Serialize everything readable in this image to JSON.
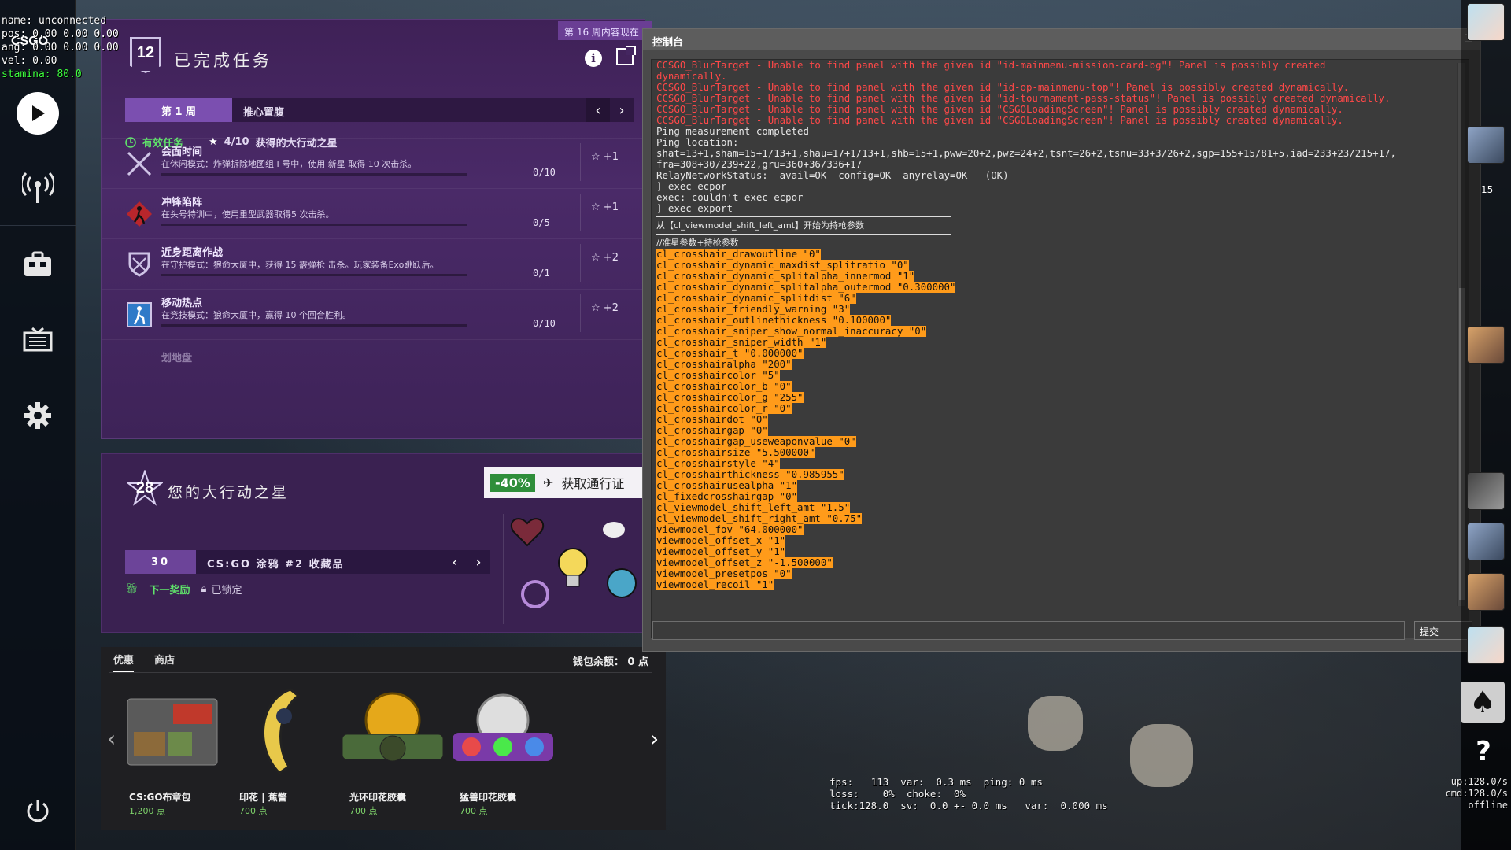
{
  "hud": {
    "line1": "name: unconnected",
    "line2": "pos:  0.00 0.00 0.00",
    "line3": "ang:  0.00 0.00 0.00",
    "line4": "vel:  0.00",
    "stamina": "stamina:  80.0",
    "logo": "CSGO"
  },
  "rail": {
    "play_icon": "play-icon",
    "broadcast_icon": "broadcast-icon",
    "inventory_icon": "briefcase-icon",
    "watch_icon": "tv-icon",
    "settings_icon": "gear-icon",
    "power_icon": "power-icon"
  },
  "missions": {
    "badge_number": "12",
    "title": "已完成任务",
    "week_tag": "第 16 周内容现在",
    "week_label": "第 1 周",
    "week_name": "推心置腹",
    "active_label": "有效任务",
    "stars_progress": "4/10",
    "stars_label": "获得的大行动之星",
    "items": [
      {
        "title": "会面时间",
        "desc": "在休闲模式：炸弹拆除地图组 I 号中，使用 新星 取得 10 次击杀。",
        "progress": "0/10",
        "reward": "+1",
        "icon": "crossed-swords-icon",
        "fraction": 0.0
      },
      {
        "title": "冲锋陷阵",
        "desc": "在头号特训中，使用重型武器取得5 次击杀。",
        "progress": "0/5",
        "reward": "+1",
        "icon": "running-man-icon",
        "fraction": 0.0
      },
      {
        "title": "近身距离作战",
        "desc": "在守护模式：狼命大厦中，获得 15 霰弹枪 击杀。玩家装备Exo跳跃后。",
        "progress": "0/1",
        "reward": "+2",
        "icon": "shield-icon",
        "fraction": 0.0
      },
      {
        "title": "移动热点",
        "desc": "在竞技模式：狼命大厦中，赢得 10 个回合胜利。",
        "progress": "0/10",
        "reward": "+2",
        "icon": "ct-player-icon",
        "fraction": 0.0
      }
    ],
    "partial_item": "划地盘"
  },
  "stars": {
    "count": "28",
    "title": "您的大行动之星",
    "discount": "-40%",
    "pass_label": "获取通行证",
    "collection_num": "30",
    "collection_name": "CS:GO 涂鸦 #2 收藏品",
    "next_reward": "下一奖励",
    "locked": "已锁定"
  },
  "store": {
    "tab_deals": "优惠",
    "tab_store": "商店",
    "wallet": "钱包余额： 0 点",
    "items": [
      {
        "name": "CS:GO布章包",
        "price": "1,200 点"
      },
      {
        "name": "印花 | 蕉警",
        "price": "700 点"
      },
      {
        "name": "光环印花胶囊",
        "price": "700 点"
      },
      {
        "name": "猛兽印花胶囊",
        "price": "700 点"
      }
    ]
  },
  "console": {
    "title": "控制台",
    "errors": [
      "CCSGO_BlurTarget - Unable to find panel with the given id \"id-mainmenu-mission-card-bg\"! Panel is possibly created",
      "dynamically.",
      "CCSGO_BlurTarget - Unable to find panel with the given id \"id-op-mainmenu-top\"! Panel is possibly created dynamically.",
      "CCSGO_BlurTarget - Unable to find panel with the given id \"id-tournament-pass-status\"! Panel is possibly created dynamically.",
      "CCSGO_BlurTarget - Unable to find panel with the given id \"CSGOLoadingScreen\"! Panel is possibly created dynamically.",
      "CCSGO_BlurTarget - Unable to find panel with the given id \"CSGOLoadingScreen\"! Panel is possibly created dynamically."
    ],
    "normal": [
      "Ping measurement completed",
      "Ping location:",
      "shat=13+1,sham=15+1/13+1,shau=17+1/13+1,shb=15+1,pww=20+2,pwz=24+2,tsnt=26+2,tsnu=33+3/26+2,sgp=155+15/81+5,iad=233+23/215+17,",
      "fra=308+30/239+22,gru=360+36/336+17",
      "RelayNetworkStatus:  avail=OK  config=OK  anyrelay=OK   (OK)",
      "] exec ecpor",
      "exec: couldn't exec ecpor",
      "] exec export"
    ],
    "header_line": "从【cl_viewmodel_shift_left_amt】开始为持枪参数",
    "comment_line": "//准星参数+持枪参数",
    "highlighted": [
      "cl_crosshair_drawoutline \"0\"",
      "cl_crosshair_dynamic_maxdist_splitratio \"0\"",
      "cl_crosshair_dynamic_splitalpha_innermod \"1\"",
      "cl_crosshair_dynamic_splitalpha_outermod \"0.300000\"",
      "cl_crosshair_dynamic_splitdist \"6\"",
      "cl_crosshair_friendly_warning \"3\"",
      "cl_crosshair_outlinethickness \"0.100000\"",
      "cl_crosshair_sniper_show_normal_inaccuracy \"0\"",
      "cl_crosshair_sniper_width \"1\"",
      "cl_crosshair_t \"0.000000\"",
      "cl_crosshairalpha \"200\"",
      "cl_crosshaircolor \"5\"",
      "cl_crosshaircolor_b \"0\"",
      "cl_crosshaircolor_g \"255\"",
      "cl_crosshaircolor_r \"0\"",
      "cl_crosshairdot \"0\"",
      "cl_crosshairgap \"0\"",
      "cl_crosshairgap_useweaponvalue \"0\"",
      "cl_crosshairsize \"5.500000\"",
      "cl_crosshairstyle \"4\"",
      "cl_crosshairthickness \"0.985955\"",
      "cl_crosshairusealpha \"1\"",
      "cl_fixedcrosshairgap \"0\"",
      "cl_viewmodel_shift_left_amt \"1.5\"",
      "cl_viewmodel_shift_right_amt \"0.75\"",
      "viewmodel_fov \"64.000000\"",
      "viewmodel_offset_x \"1\"",
      "viewmodel_offset_y \"1\"",
      "viewmodel_offset_z \"-1.500000\"",
      "viewmodel_presetpos \"0\"",
      "viewmodel_recoil \"1\""
    ],
    "submit_label": "提交"
  },
  "netgraph": {
    "line1": "fps:   113  var:  0.3 ms  ping: 0 ms",
    "line2": "loss:    0%  choke:  0%",
    "line3": "tick:128.0  sv:  0.0 +- 0.0 ms   var:  0.000 ms"
  },
  "friends_panel": {
    "count": "15",
    "stat_line1": "up:128.0/s",
    "stat_line2": "cmd:128.0/s",
    "stat_line3": "offline",
    "help": "?"
  },
  "colors": {
    "purple_panel": "#4a2a68",
    "highlight": "#ff9b1a",
    "error_text": "#ff4848",
    "green": "#5fe36a"
  }
}
